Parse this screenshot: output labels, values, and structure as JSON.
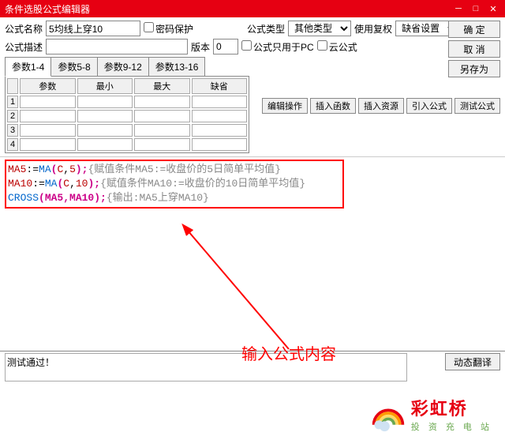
{
  "window": {
    "title": "条件选股公式编辑器"
  },
  "fields": {
    "name_label": "公式名称",
    "name_value": "5均线上穿10",
    "pwd_label": "密码保护",
    "type_label": "公式类型",
    "type_value": "其他类型",
    "auth_label": "使用复权",
    "auth_value": "缺省设置",
    "desc_label": "公式描述",
    "desc_value": "",
    "ver_label": "版本",
    "ver_value": "0",
    "pconly_label": "公式只用于PC",
    "cloud_label": "云公式"
  },
  "buttons": {
    "ok": "确 定",
    "cancel": "取 消",
    "saveas": "另存为",
    "editop": "编辑操作",
    "insfn": "插入函数",
    "insres": "插入资源",
    "impfml": "引入公式",
    "testfml": "测试公式",
    "dyntrans": "动态翻译"
  },
  "tabs": [
    "参数1-4",
    "参数5-8",
    "参数9-12",
    "参数13-16"
  ],
  "ptable": {
    "cols": [
      "参数",
      "最小",
      "最大",
      "缺省"
    ],
    "rows": [
      1,
      2,
      3,
      4
    ]
  },
  "code": {
    "l1a": "MA5",
    "l1b": ":=",
    "l1c": "MA",
    "l1d": "(",
    "l1e": "C",
    "l1f": ",",
    "l1g": "5",
    "l1h": ");",
    "l1i": "{赋值条件MA5:=收盘价的5日简单平均值}",
    "l2a": "MA10",
    "l2b": ":=",
    "l2c": "MA",
    "l2d": "(",
    "l2e": "C",
    "l2f": ",",
    "l2g": "10",
    "l2h": ");",
    "l2i": "{赋值条件MA10:=收盘价的10日简单平均值}",
    "l3a": "CROSS",
    "l3b": "(MA5,MA10);",
    "l3c": "{输出:MA5上穿MA10}"
  },
  "annot": "输入公式内容",
  "status": "测试通过！",
  "logo": {
    "name": "彩虹桥",
    "tag": "投 资 充 电 站"
  }
}
